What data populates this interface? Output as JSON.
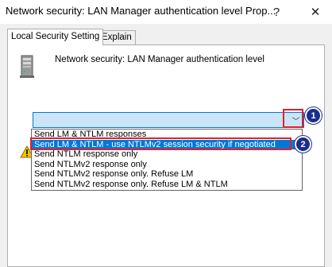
{
  "window": {
    "title": "Network security: LAN Manager authentication level Prop...",
    "help_glyph": "?",
    "close_glyph": "✕"
  },
  "tabs": [
    {
      "label": "Local Security Setting",
      "active": true
    },
    {
      "label": "Explain",
      "active": false
    }
  ],
  "policy": {
    "icon": "server-icon",
    "title": "Network security: LAN Manager authentication level"
  },
  "combo": {
    "arrow_glyph": "﹀"
  },
  "dropdown": {
    "options": [
      "Send LM & NTLM responses",
      "Send LM & NTLM - use NTLMv2 session security if negotiated",
      "Send NTLM response only",
      "Send NTLMv2 response only",
      "Send NTLMv2 response only. Refuse LM",
      "Send NTLMv2 response only. Refuse LM & NTLM"
    ],
    "selected_index": 1
  },
  "callouts": [
    {
      "number": "1",
      "target": "combo-arrow"
    },
    {
      "number": "2",
      "target": "dropdown-option-selected"
    }
  ],
  "colors": {
    "accent": "#0078d7",
    "combo_fill": "#cce4f7",
    "callout_border": "#e0202a",
    "badge": "#1b2d8c"
  }
}
